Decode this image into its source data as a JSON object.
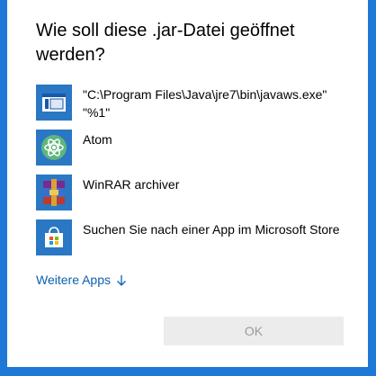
{
  "dialog": {
    "title": "Wie soll diese .jar-Datei geöffnet werden?",
    "apps": [
      {
        "label": "\"C:\\Program Files\\Java\\jre7\\bin\\javaws.exe\" \"%1\"",
        "icon": "java-webstart-icon"
      },
      {
        "label": "Atom",
        "icon": "atom-icon"
      },
      {
        "label": "WinRAR archiver",
        "icon": "winrar-icon"
      },
      {
        "label": "Suchen Sie nach einer App im Microsoft Store",
        "icon": "microsoft-store-icon"
      }
    ],
    "more_apps_label": "Weitere Apps",
    "ok_label": "OK"
  },
  "colors": {
    "desktop_background": "#1e78d8",
    "icon_tile": "#2a77c4",
    "link": "#0a60b0",
    "button_disabled_bg": "#ececec",
    "button_disabled_text": "#9a9a9a"
  }
}
